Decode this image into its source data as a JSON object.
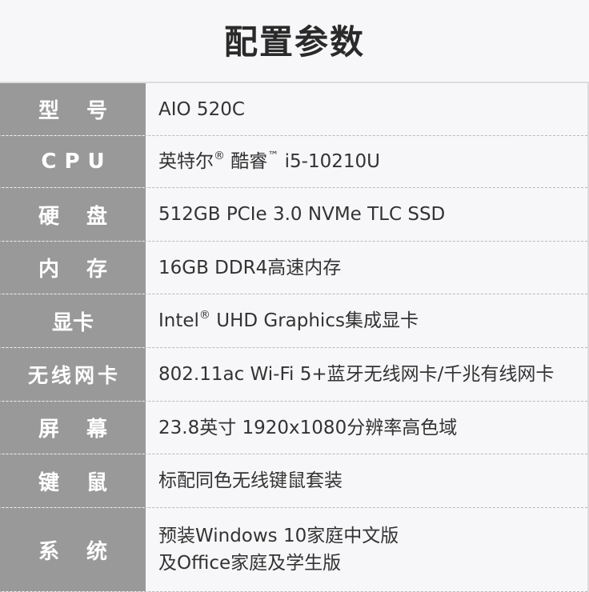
{
  "header": {
    "title": "配置参数"
  },
  "colors": {
    "label_bg": "#999999",
    "label_text": "#ffffff",
    "value_text": "#333333",
    "page_bg": "#f7f7f9"
  },
  "specs": [
    {
      "label": "型号",
      "value": "AIO 520C"
    },
    {
      "label": "CPU",
      "value_parts": [
        "英特尔",
        "®",
        " 酷睿",
        "™",
        " i5-10210U"
      ]
    },
    {
      "label": "硬盘",
      "value": "512GB PCIe 3.0 NVMe TLC SSD"
    },
    {
      "label": "内存",
      "value": "16GB DDR4高速内存"
    },
    {
      "label": "显卡",
      "value_parts": [
        "Intel",
        "®",
        " UHD Graphics集成显卡"
      ]
    },
    {
      "label": "无线网卡",
      "value": "802.11ac Wi-Fi 5+蓝牙无线网卡/千兆有线网卡"
    },
    {
      "label": "屏幕",
      "value": "23.8英寸 1920x1080分辨率高色域"
    },
    {
      "label": "键鼠",
      "value": "标配同色无线键鼠套装"
    },
    {
      "label": "系统",
      "value_lines": [
        "预装Windows 10家庭中文版",
        "及Office家庭及学生版"
      ]
    }
  ]
}
